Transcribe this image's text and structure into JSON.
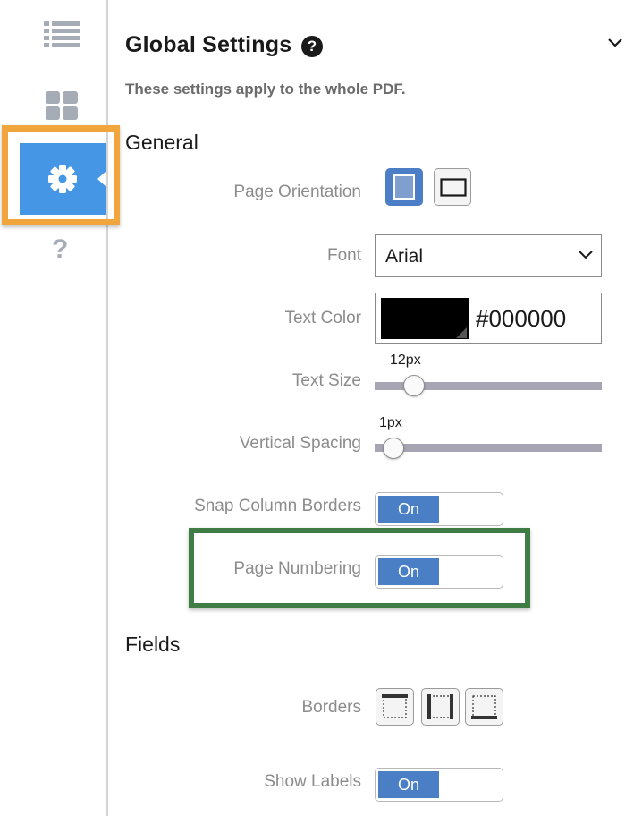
{
  "sidebar": {
    "items": [
      {
        "icon": "list-icon",
        "active": false
      },
      {
        "icon": "grid-icon",
        "active": false
      },
      {
        "icon": "gear-icon",
        "active": true
      },
      {
        "icon": "question-icon",
        "active": false,
        "glyph": "?"
      }
    ]
  },
  "header": {
    "title": "Global Settings",
    "help_glyph": "?",
    "subtitle": "These settings apply to the whole PDF."
  },
  "general": {
    "section_title": "General",
    "page_orientation": {
      "label": "Page Orientation",
      "selected": "portrait"
    },
    "font": {
      "label": "Font",
      "value": "Arial"
    },
    "text_color": {
      "label": "Text Color",
      "value": "#000000"
    },
    "text_size": {
      "label": "Text Size",
      "value_text": "12px",
      "level": 0.1
    },
    "vertical_spacing": {
      "label": "Vertical Spacing",
      "value_text": "1px",
      "level": 0.05
    },
    "snap_column_borders": {
      "label": "Snap Column Borders",
      "state": "On"
    },
    "page_numbering": {
      "label": "Page Numbering",
      "state": "On"
    }
  },
  "fields": {
    "section_title": "Fields",
    "borders": {
      "label": "Borders"
    },
    "show_labels": {
      "label": "Show Labels",
      "state": "On"
    }
  },
  "colors": {
    "accent_blue": "#4597e6",
    "toggle_blue": "#4a7fc6",
    "highlight_orange": "#f0a63c",
    "highlight_green": "#3f7d45"
  }
}
